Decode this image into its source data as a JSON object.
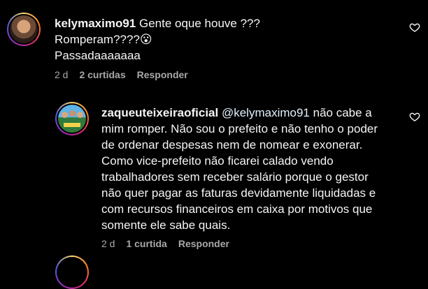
{
  "comment1": {
    "username": "kelymaximo91",
    "line1": "Gente oque houve ???",
    "line2": "Romperam????",
    "emoji": "😮",
    "line3": "Passadaaaaaaa",
    "time": "2 d",
    "likes": "2 curtidas",
    "reply": "Responder"
  },
  "comment2": {
    "username": "zaqueuteixeiraoficial",
    "mention": "@kelymaximo91",
    "first_line_rest": "não cabe a",
    "lines": [
      "mim romper. Não sou o prefeito e não tenho o poder",
      "de ordenar despesas nem de nomear e exonerar.",
      "Como vice-prefeito não ficarei calado vendo",
      "trabalhadores sem receber salário porque o gestor",
      "não quer pagar as faturas devidamente liquidadas e",
      "com recursos financeiros em caixa por motivos que",
      "somente ele sabe quais."
    ],
    "time": "2 d",
    "likes": "1 curtida",
    "reply": "Responder"
  },
  "icons": {
    "like": "heart-outline-icon"
  },
  "colors": {
    "background": "#000000",
    "text": "#f5f5f5",
    "meta": "#a8a8a8",
    "mention": "#e0f1ff"
  }
}
